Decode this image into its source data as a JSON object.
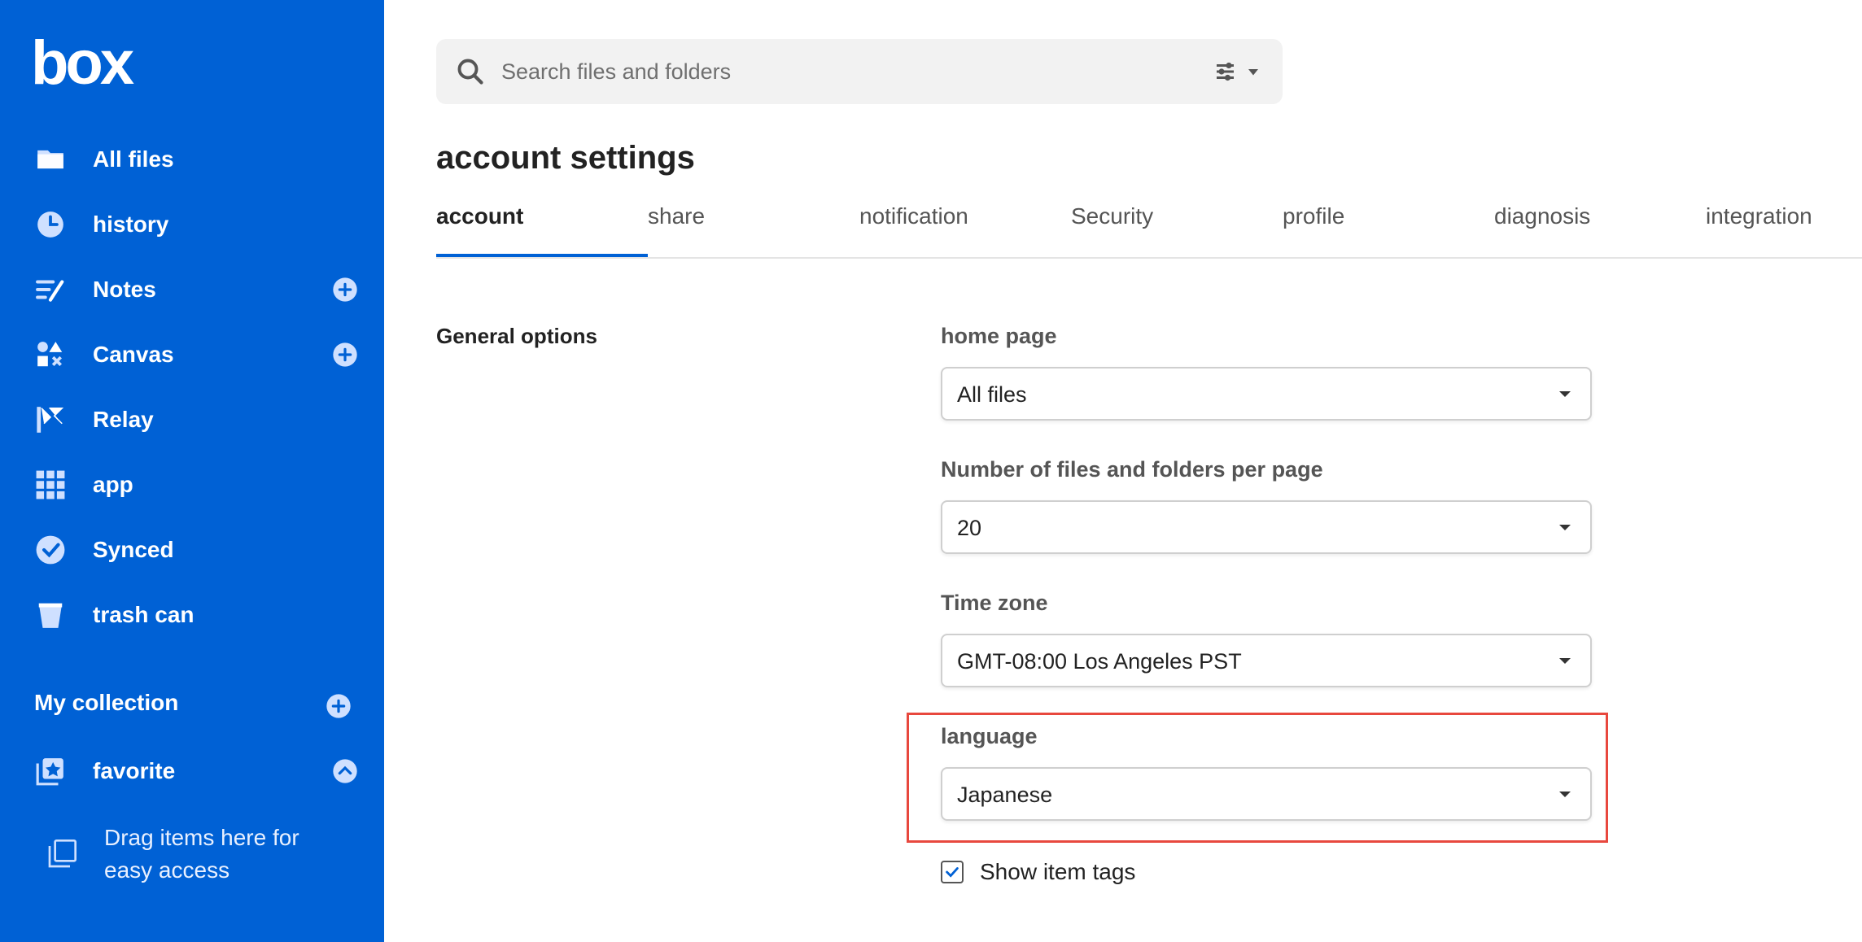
{
  "brand": {
    "logo_text": "box",
    "accent": "#0061d5",
    "highlight": "#e8483e"
  },
  "sidebar": {
    "items": [
      {
        "label": "All files",
        "icon": "folder-icon"
      },
      {
        "label": "history",
        "icon": "clock-icon"
      },
      {
        "label": "Notes",
        "icon": "notes-icon",
        "has_add": true
      },
      {
        "label": "Canvas",
        "icon": "canvas-icon",
        "has_add": true
      },
      {
        "label": "Relay",
        "icon": "relay-icon"
      },
      {
        "label": "app",
        "icon": "grid-icon"
      },
      {
        "label": "Synced",
        "icon": "check-circle-icon"
      },
      {
        "label": "trash can",
        "icon": "trash-icon"
      }
    ],
    "collection_title": "My collection",
    "favorite_label": "favorite",
    "drag_hint": "Drag items here for easy access"
  },
  "search": {
    "placeholder": "Search files and folders",
    "value": ""
  },
  "page": {
    "title": "account settings"
  },
  "tabs": [
    {
      "label": "account",
      "active": true
    },
    {
      "label": "share"
    },
    {
      "label": "notification"
    },
    {
      "label": "Security"
    },
    {
      "label": "profile"
    },
    {
      "label": "diagnosis"
    },
    {
      "label": "integration"
    }
  ],
  "settings": {
    "section_label": "General options",
    "home_page": {
      "label": "home page",
      "value": "All files"
    },
    "per_page": {
      "label": "Number of files and folders per page",
      "value": "20"
    },
    "time_zone": {
      "label": "Time zone",
      "value": "GMT-08:00 Los Angeles PST"
    },
    "language": {
      "label": "language",
      "value": "Japanese"
    },
    "show_tags": {
      "label": "Show item tags",
      "checked": true
    }
  }
}
